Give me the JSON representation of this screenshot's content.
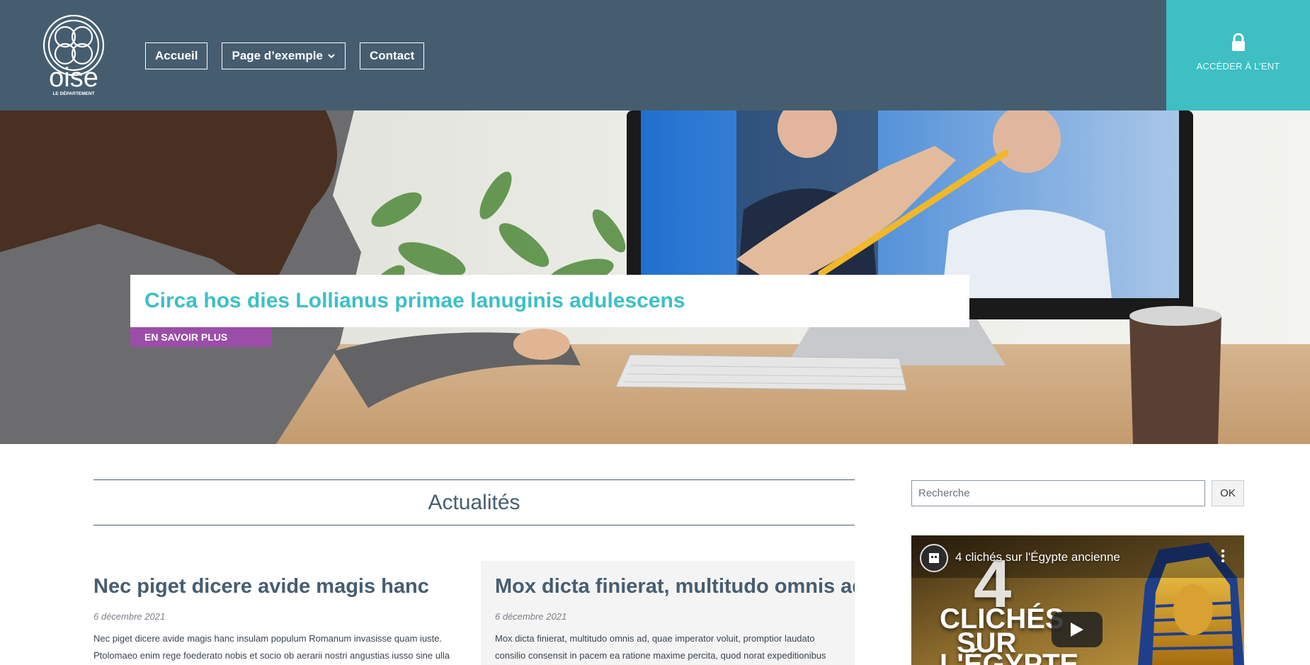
{
  "header": {
    "logo": {
      "text": "oise",
      "subtitle": "LE DÉPARTEMENT"
    },
    "nav": [
      {
        "label": "Accueil"
      },
      {
        "label": "Page d’exemple",
        "has_dropdown": true
      },
      {
        "label": "Contact"
      }
    ],
    "ent_button": {
      "label": "ACCÉDER À L’ENT",
      "icon": "lock-icon"
    },
    "colors": {
      "background": "#465d70",
      "ent": "#3dbfc4"
    }
  },
  "hero": {
    "title": "Circa hos dies Lollianus primae lanuginis adulescens",
    "cta_label": "EN SAVOIR PLUS",
    "colors": {
      "title": "#3dbfc4",
      "cta": "#9b4ea8"
    }
  },
  "news": {
    "section_title": "Actualités",
    "articles": [
      {
        "title": "Nec piget dicere avide magis hanc",
        "date": "6 décembre 2021",
        "excerpt": "Nec piget dicere avide magis hanc insulam populum Romanum invasisse quam iuste. Ptolomaeo enim rege foederato nobis et socio ob aerarii nostri angustias iusso sine ulla"
      },
      {
        "title": "Mox dicta finierat, multitudo omnis ad",
        "date": "6 décembre 2021",
        "excerpt": "Mox dicta finierat, multitudo omnis ad, quae imperator voluit, promptior laudato consilio consensit in pacem ea ratione maxime percita, quod norat expeditionibus"
      }
    ]
  },
  "sidebar": {
    "search": {
      "placeholder": "Recherche",
      "value": "",
      "button_label": "OK"
    },
    "video": {
      "title": "4 clichés sur l'Égypte ancienne",
      "thumb_number": "4",
      "thumb_line1": "CLICHÉS",
      "thumb_line2": "SUR",
      "thumb_line3": "L'ÉGYPTE"
    }
  }
}
